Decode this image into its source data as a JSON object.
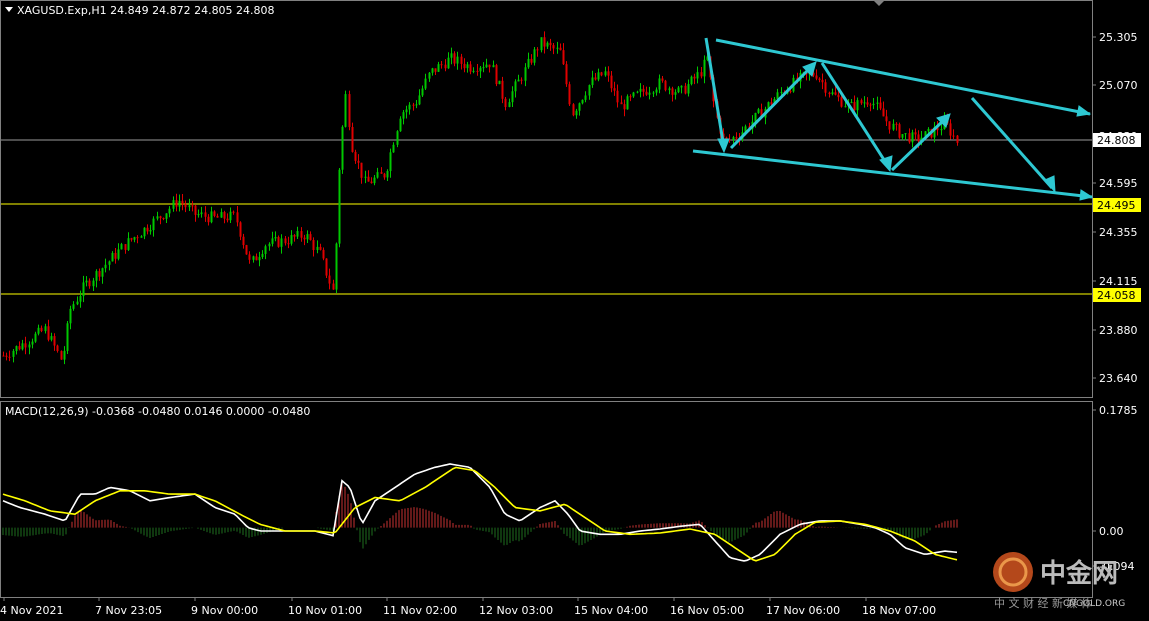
{
  "chart_data": {
    "type": "candlestick",
    "title": "XAGUSD.Exp,H1  24.849 24.872 24.805 24.808",
    "symbol": "XAGUSD.Exp,H1",
    "ohlc_last": {
      "open": 24.849,
      "high": 24.872,
      "low": 24.805,
      "close": 24.808
    },
    "price_axis": {
      "ticks": [
        "25.305",
        "25.070",
        "24.595",
        "24.355",
        "24.115",
        "23.880",
        "23.640"
      ],
      "ylim": [
        23.55,
        25.5
      ]
    },
    "time_axis": {
      "ticks": [
        "4 Nov 2021",
        "7 Nov 23:05",
        "9 Nov 00:00",
        "10 Nov 01:00",
        "11 Nov 02:00",
        "12 Nov 03:00",
        "15 Nov 04:00",
        "16 Nov 05:00",
        "17 Nov 06:00",
        "18 Nov 07:00"
      ]
    },
    "price_labels": {
      "current": "24.808",
      "support_1": "24.495",
      "support_2": "24.058"
    },
    "levels": [
      {
        "name": "current",
        "value": 24.808,
        "color": "#b4b4b4"
      },
      {
        "name": "support_1",
        "value": 24.495,
        "color": "#ffff00"
      },
      {
        "name": "support_2",
        "value": 24.058,
        "color": "#ffff00"
      }
    ],
    "macd": {
      "title": "MACD(12,26,9) -0.0368 -0.0480 0.0146 0.0000 -0.0480",
      "ticks": [
        "0.1785",
        "0.00",
        "-0.094"
      ],
      "ylim": [
        -0.102,
        0.1875
      ]
    },
    "colors": {
      "up": "#00c800",
      "down": "#e00000",
      "level": "#ffff00",
      "trend": "#2ec8d2",
      "macd_line": "#ffffff",
      "signal_line": "#ffff00",
      "hist_pos": "#c83232",
      "hist_neg": "#1e6e1e"
    }
  },
  "watermark": {
    "brand": "中金网",
    "domain": "CNGOLD.ORG",
    "tagline": "中 文 财 经 新 媒 体"
  }
}
